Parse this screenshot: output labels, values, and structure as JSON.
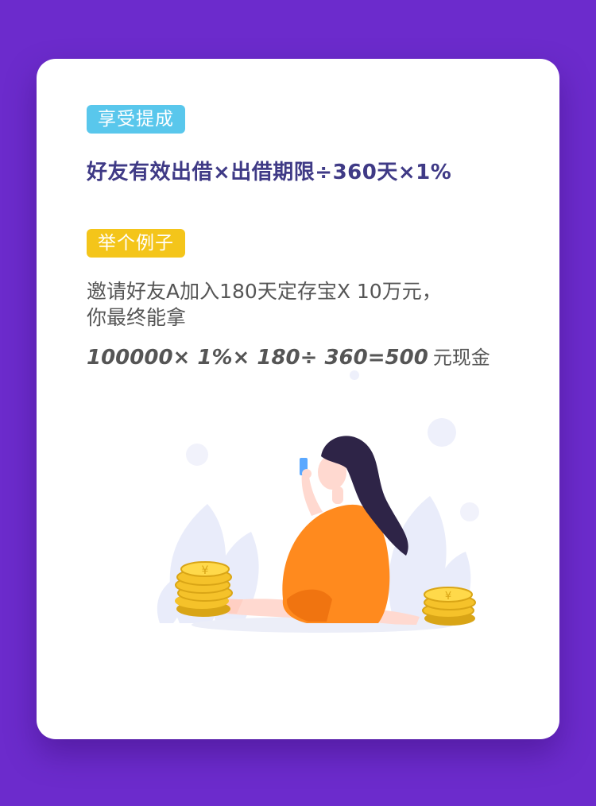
{
  "section1": {
    "tag": "享受提成",
    "formula": "好友有效出借×出借期限÷360天×1%"
  },
  "section2": {
    "tag": "举个例子",
    "example_line1": "邀请好友A加入180天定存宝X  10万元，",
    "example_line2": "你最终能拿",
    "calc_expression": "100000× 1%× 180÷ 360=500",
    "calc_unit": "元现金"
  },
  "colors": {
    "background": "#6c2bcc",
    "card": "#ffffff",
    "tag_blue": "#59c7ec",
    "tag_yellow": "#f4c51a",
    "formula_text": "#3f3a86",
    "body_text": "#555555",
    "dress": "#ff8a1e",
    "coin": "#f5c22a",
    "hair": "#2e2447"
  },
  "illustration": {
    "subject": "woman-in-orange-dress-with-phone",
    "coins_icon": "yuan-coin-stack-icon"
  }
}
